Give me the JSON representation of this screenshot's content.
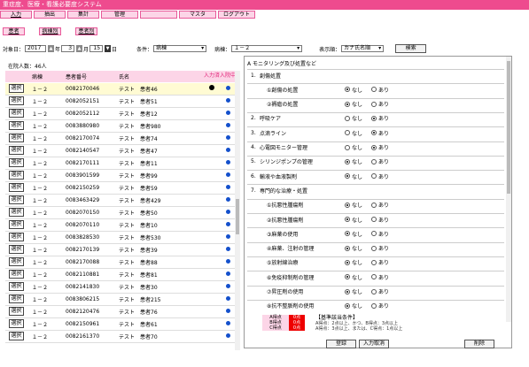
{
  "app": {
    "title": "重症度、医療・看護必要度システム"
  },
  "nav": {
    "tabs": [
      {
        "label": "入力",
        "active": true
      },
      {
        "label": "抽出"
      },
      {
        "label": "集計"
      },
      {
        "label": "管理"
      },
      {
        "label": "",
        "dim": true
      },
      {
        "label": "マスタ"
      },
      {
        "label": "ログアウト"
      }
    ]
  },
  "subnav": {
    "tabs": [
      "患者",
      "病棟別",
      "患者別"
    ]
  },
  "filters": {
    "date_label": "対象日：",
    "year": "2017",
    "year_unit": "年",
    "month": "3",
    "month_unit": "月",
    "day": "15",
    "day_unit": "日",
    "condition_label": "条件：",
    "condition": "病棟",
    "ward_label": "病棟：",
    "ward": "１－２",
    "display_label": "表示順：",
    "display": "カナ氏名順",
    "search_button": "検索"
  },
  "patients": {
    "count_text": "在院人数：46人",
    "headers": [
      "病棟",
      "患者番号",
      "氏名",
      "入力済",
      "入院中"
    ],
    "select_label": "選択",
    "rows": [
      {
        "ward": "１－２",
        "id": "0082170046",
        "name": "テスト　患者46",
        "entered": true,
        "admitted": true
      },
      {
        "ward": "１－２",
        "id": "0082052151",
        "name": "テスト　患者51",
        "entered": false,
        "admitted": true
      },
      {
        "ward": "１－２",
        "id": "0082052112",
        "name": "テスト　患者12",
        "entered": false,
        "admitted": true
      },
      {
        "ward": "１－２",
        "id": "0083880980",
        "name": "テスト　患者980",
        "entered": false,
        "admitted": true
      },
      {
        "ward": "１－２",
        "id": "0082170074",
        "name": "テスト　患者74",
        "entered": false,
        "admitted": true
      },
      {
        "ward": "１－２",
        "id": "0082140547",
        "name": "テスト　患者47",
        "entered": false,
        "admitted": true
      },
      {
        "ward": "１－２",
        "id": "0082170111",
        "name": "テスト　患者11",
        "entered": false,
        "admitted": true
      },
      {
        "ward": "１－２",
        "id": "0083901599",
        "name": "テスト　患者99",
        "entered": false,
        "admitted": true
      },
      {
        "ward": "１－２",
        "id": "0082150259",
        "name": "テスト　患者59",
        "entered": false,
        "admitted": true
      },
      {
        "ward": "１－２",
        "id": "0083463429",
        "name": "テスト　患者429",
        "entered": false,
        "admitted": true
      },
      {
        "ward": "１－２",
        "id": "0082070150",
        "name": "テスト　患者50",
        "entered": false,
        "admitted": true
      },
      {
        "ward": "１－２",
        "id": "0082070110",
        "name": "テスト　患者10",
        "entered": false,
        "admitted": true
      },
      {
        "ward": "１－２",
        "id": "0083828530",
        "name": "テスト　患者530",
        "entered": false,
        "admitted": true
      },
      {
        "ward": "１－２",
        "id": "0082170139",
        "name": "テスト　患者39",
        "entered": false,
        "admitted": true
      },
      {
        "ward": "１－２",
        "id": "0082170088",
        "name": "テスト　患者88",
        "entered": false,
        "admitted": true
      },
      {
        "ward": "１－２",
        "id": "0082110881",
        "name": "テスト　患者81",
        "entered": false,
        "admitted": true
      },
      {
        "ward": "１－２",
        "id": "0082141830",
        "name": "テスト　患者30",
        "entered": false,
        "admitted": true
      },
      {
        "ward": "１－２",
        "id": "0083806215",
        "name": "テスト　患者215",
        "entered": false,
        "admitted": true
      },
      {
        "ward": "１－２",
        "id": "0082120476",
        "name": "テスト　患者76",
        "entered": false,
        "admitted": true
      },
      {
        "ward": "１－２",
        "id": "0082150961",
        "name": "テスト　患者61",
        "entered": false,
        "admitted": true
      },
      {
        "ward": "１－２",
        "id": "0082161370",
        "name": "テスト　患者70",
        "entered": false,
        "admitted": true
      }
    ]
  },
  "monitoring": {
    "title": "A モニタリング及び処置など",
    "items": [
      {
        "num": "1.",
        "label": "創傷処置",
        "header": true
      },
      {
        "num": "",
        "label": "①創傷の処置",
        "value": "なし"
      },
      {
        "num": "",
        "label": "②褥瘡の処置",
        "value": "なし"
      },
      {
        "num": "2.",
        "label": "呼吸ケア",
        "value": "あり"
      },
      {
        "num": "3.",
        "label": "点滴ライン",
        "value": "あり"
      },
      {
        "num": "4.",
        "label": "心電図モニター管理",
        "value": "あり"
      },
      {
        "num": "5.",
        "label": "シリンジポンプの管理",
        "value": "なし"
      },
      {
        "num": "6.",
        "label": "輸液や血液製剤",
        "value": "なし"
      },
      {
        "num": "7.",
        "label": "専門的な治療・処置",
        "header": true
      },
      {
        "num": "",
        "label": "①抗悪性腫瘍剤",
        "value": "なし"
      },
      {
        "num": "",
        "label": "②抗悪性腫瘍剤",
        "value": "なし"
      },
      {
        "num": "",
        "label": "③麻薬の使用",
        "value": "なし"
      },
      {
        "num": "",
        "label": "④麻薬、注射の管理",
        "value": "なし"
      },
      {
        "num": "",
        "label": "⑤放射線治療",
        "value": "なし"
      },
      {
        "num": "",
        "label": "⑥免疫抑制剤の管理",
        "value": "なし"
      },
      {
        "num": "",
        "label": "⑦昇圧剤の使用",
        "value": "なし"
      },
      {
        "num": "",
        "label": "⑧抗不整脈剤の使用",
        "value": "なし"
      }
    ],
    "opt_none": "なし",
    "opt_yes": "あり"
  },
  "scores": [
    {
      "label": "A得点",
      "value": "0点"
    },
    {
      "label": "B得点",
      "value": "0点"
    },
    {
      "label": "C得点",
      "value": "0点"
    }
  ],
  "criteria": {
    "title": "【基準該当条件】",
    "line1": "A得点：2点以上、かつ、B得点：3点以上",
    "line2": "A得点：3点以上、または、C得点：1点以上"
  },
  "buttons": {
    "register": "登録",
    "cancel": "入力取消",
    "delete": "削除"
  }
}
